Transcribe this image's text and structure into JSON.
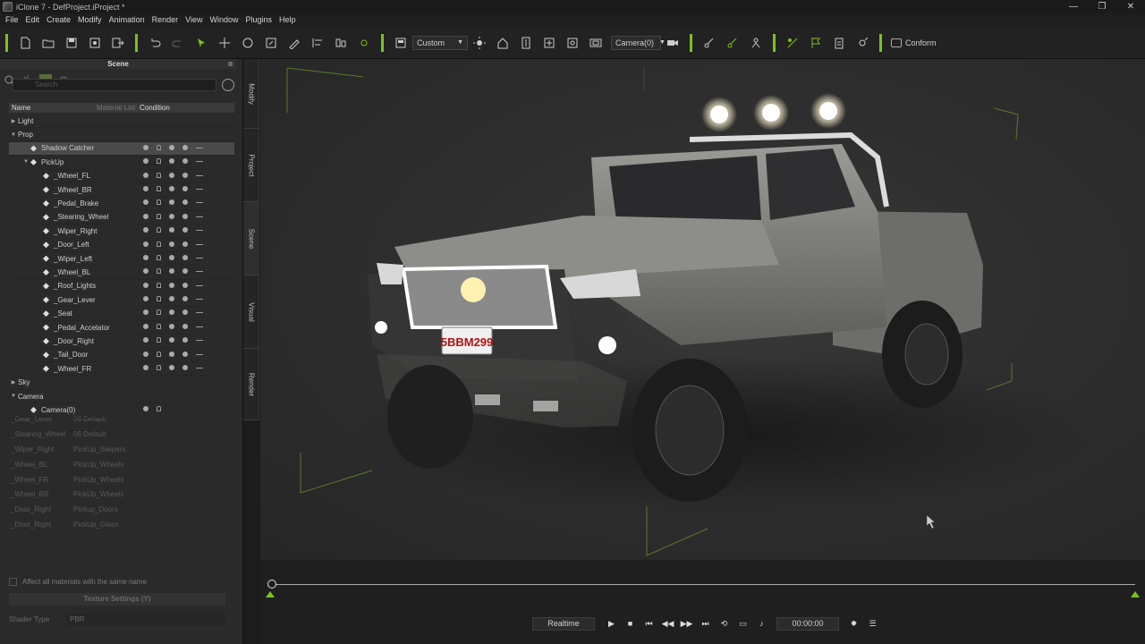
{
  "window": {
    "title": "iClone 7 - DefProject.iProject *",
    "controls": [
      "—",
      "❐",
      "✕"
    ]
  },
  "menu": [
    "File",
    "Edit",
    "Create",
    "Modify",
    "Animation",
    "Render",
    "View",
    "Window",
    "Plugins",
    "Help"
  ],
  "toolbar": {
    "preset": "Custom",
    "camera": "Camera(0)",
    "conform": "Conform",
    "accent": "#7bc21e"
  },
  "scene_panel": {
    "title": "Scene",
    "search_placeholder": "Search",
    "columns": {
      "name": "Name",
      "material_list": "Material List",
      "condition": "Condition"
    },
    "tree": [
      {
        "label": "Light",
        "level": 0,
        "expand": "▶"
      },
      {
        "label": "Prop",
        "level": 0,
        "expand": "▼"
      },
      {
        "label": "Shadow Catcher",
        "level": 1,
        "highlight": true
      },
      {
        "label": "PickUp",
        "level": 1,
        "expand": "▼"
      },
      {
        "label": "_Wheel_FL",
        "level": 2
      },
      {
        "label": "_Wheel_BR",
        "level": 2
      },
      {
        "label": "_Pedal_Brake",
        "level": 2
      },
      {
        "label": "_Stearing_Wheel",
        "level": 2
      },
      {
        "label": "_Wiper_Right",
        "level": 2
      },
      {
        "label": "_Door_Left",
        "level": 2
      },
      {
        "label": "_Wiper_Left",
        "level": 2
      },
      {
        "label": "_Wheel_BL",
        "level": 2
      },
      {
        "label": "_Roof_Lights",
        "level": 2
      },
      {
        "label": "_Gear_Lever",
        "level": 2
      },
      {
        "label": "_Seat",
        "level": 2
      },
      {
        "label": "_Pedal_Accelator",
        "level": 2
      },
      {
        "label": "_Door_Right",
        "level": 2
      },
      {
        "label": "_Tail_Door",
        "level": 2
      },
      {
        "label": "_Wheel_FR",
        "level": 2
      },
      {
        "label": "Sky",
        "level": 0,
        "expand": "▶"
      },
      {
        "label": "Camera",
        "level": 0,
        "expand": "▼"
      },
      {
        "label": "Camera(0)",
        "level": 1,
        "camera": true
      }
    ],
    "ghost_rows": [
      [
        "_Gear_Lever",
        "06 Default"
      ],
      [
        "_Stearing_Wheel",
        "06 Default"
      ],
      [
        "_Wiper_Right",
        "PickUp_Swipers"
      ],
      [
        "_Wheel_BL",
        "PickUp_Wheels"
      ],
      [
        "_Wheel_FR",
        "PickUp_Wheels"
      ],
      [
        "_Wheel_BR",
        "PickUp_Wheels"
      ],
      [
        "_Door_Right",
        "Pickup_Doors"
      ],
      [
        "_Door_Right",
        "PickUp_Glass"
      ]
    ],
    "affect_label": "Affect all materials with the same name",
    "texture_settings": "Texture Settings  (Y)",
    "shader_label": "Shader Type",
    "shader_value": "PBR"
  },
  "side_tabs": [
    "Modify",
    "Project",
    "Scene",
    "Visual",
    "Render"
  ],
  "viewport": {
    "license_plate": "5BBM299"
  },
  "timeline": {
    "mode": "Realtime",
    "time": "00:00:00"
  }
}
